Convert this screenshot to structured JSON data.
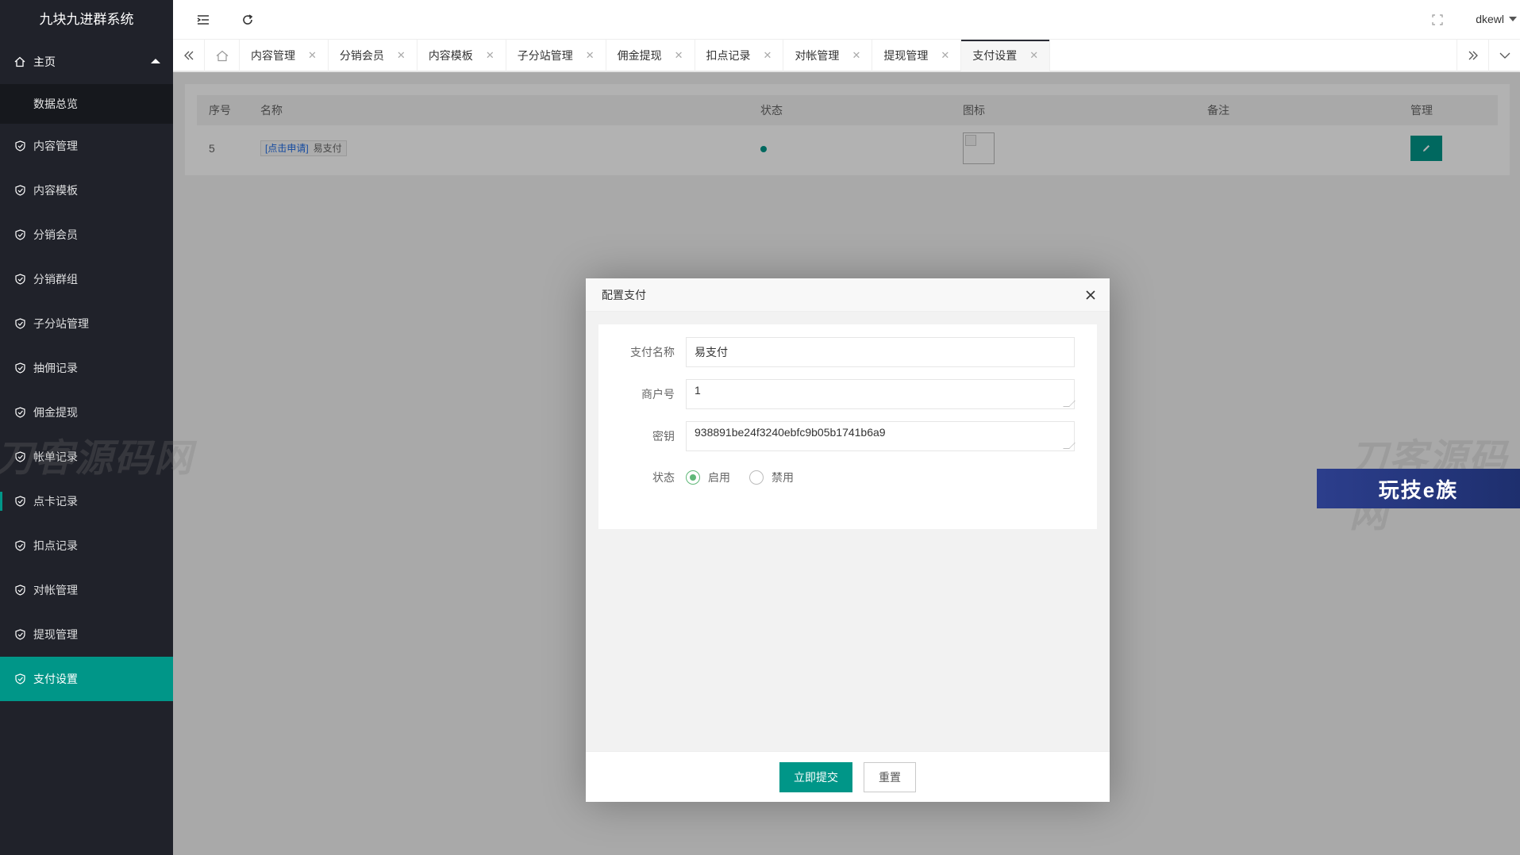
{
  "app": {
    "title": "九块九进群系统"
  },
  "sidebar": {
    "home": "主页",
    "home_sub": "数据总览",
    "items": [
      {
        "label": "内容管理"
      },
      {
        "label": "内容模板"
      },
      {
        "label": "分销会员"
      },
      {
        "label": "分销群组"
      },
      {
        "label": "子分站管理"
      },
      {
        "label": "抽佣记录"
      },
      {
        "label": "佣金提现"
      },
      {
        "label": "帐单记录"
      },
      {
        "label": "点卡记录"
      },
      {
        "label": "扣点记录"
      },
      {
        "label": "对帐管理"
      },
      {
        "label": "提现管理"
      },
      {
        "label": "支付设置"
      }
    ]
  },
  "header": {
    "user": "dkewl"
  },
  "tabs": [
    {
      "label": "内容管理"
    },
    {
      "label": "分销会员"
    },
    {
      "label": "内容模板"
    },
    {
      "label": "子分站管理"
    },
    {
      "label": "佣金提现"
    },
    {
      "label": "扣点记录"
    },
    {
      "label": "对帐管理"
    },
    {
      "label": "提现管理"
    },
    {
      "label": "支付设置"
    }
  ],
  "table": {
    "headers": [
      "序号",
      "名称",
      "状态",
      "图标",
      "备注",
      "管理"
    ],
    "rows": [
      {
        "id": "5",
        "link": "[点击申请]",
        "name": "易支付",
        "status_color": "#009688",
        "note": ""
      }
    ]
  },
  "watermarks": {
    "text": "刀客源码网",
    "banner": "玩技e族"
  },
  "modal": {
    "title": "配置支付",
    "fields": {
      "name_label": "支付名称",
      "name_value": "易支付",
      "merchant_label": "商户号",
      "merchant_value": "1",
      "key_label": "密钥",
      "key_value": "938891be24f3240ebfc9b05b1741b6a9",
      "status_label": "状态",
      "opt_on": "启用",
      "opt_off": "禁用"
    },
    "submit": "立即提交",
    "reset": "重置"
  },
  "colors": {
    "accent": "#009688",
    "sidebar": "#20222a",
    "radio_on": "#5fb878"
  }
}
